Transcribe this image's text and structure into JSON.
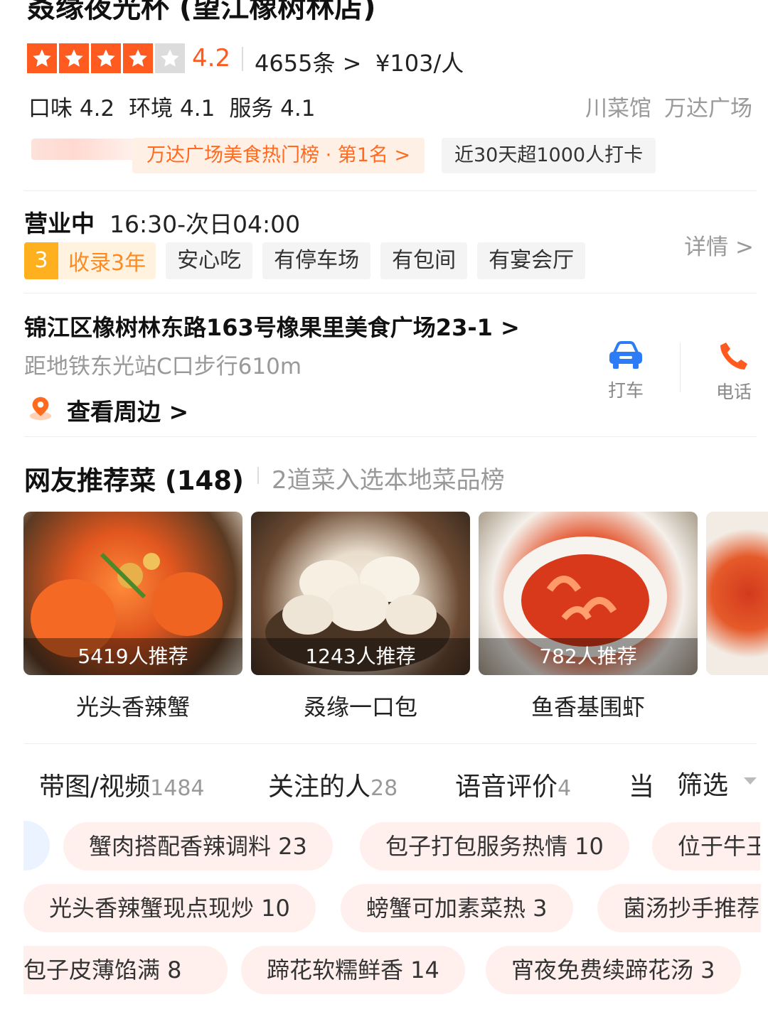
{
  "shop": {
    "name": "叒缘夜光杯 (望江橡树林店)",
    "rating": "4.2",
    "reviews": "4655条 >",
    "price": "¥103/人",
    "stars_filled": 4,
    "stars_total": 5,
    "scores": [
      "口味 4.2",
      "环境 4.1",
      "服务 4.1"
    ],
    "category_tags": [
      "川菜馆",
      "万达广场"
    ],
    "rank_badge": "万达广场美食热门榜 · 第1名 >",
    "checkin_badge": "近30天超1000人打卡"
  },
  "hours": {
    "status": "营业中",
    "time": "16:30-次日04:00",
    "details_link": "详情 >",
    "years_num": "3",
    "years_text": "收录3年",
    "features": [
      "安心吃",
      "有停车场",
      "有包间",
      "有宴会厅"
    ]
  },
  "location": {
    "address": "锦江区橡树林东路163号橡果里美食广场23-1 >",
    "metro": "距地铁东光站C口步行610m",
    "nearby": "查看周边 >",
    "taxi_label": "打车",
    "phone_label": "电话"
  },
  "dishes_section": {
    "title": "网友推荐菜 (148)",
    "subtitle": "2道菜入选本地菜品榜",
    "dishes": [
      {
        "name": "光头香辣蟹",
        "rec": "5419人推荐"
      },
      {
        "name": "叒缘一口包",
        "rec": "1243人推荐"
      },
      {
        "name": "鱼香基围虾",
        "rec": "782人推荐"
      }
    ]
  },
  "review_filters": {
    "tabs": [
      {
        "label": "带图/视频",
        "count": "1484"
      },
      {
        "label": "关注的人",
        "count": "28"
      },
      {
        "label": "语音评价",
        "count": "4"
      },
      {
        "label": "当",
        "count": ""
      }
    ],
    "filter_label": "筛选"
  },
  "keyword_tags": {
    "row1": [
      "蟹肉搭配香辣调料 23",
      "包子打包服务热情 10",
      "位于牛王"
    ],
    "row2": [
      "光头香辣蟹现点现炒 10",
      "螃蟹可加素菜热 3",
      "菌汤抄手推荐"
    ],
    "row3": [
      "包子皮薄馅满 8",
      "蹄花软糯鲜香 14",
      "宵夜免费续蹄花汤 3"
    ]
  },
  "colors": {
    "accent": "#ff5a1f",
    "rank_text": "#ff6a1f",
    "muted": "#999999",
    "pill_bg": "#fff0ee"
  }
}
